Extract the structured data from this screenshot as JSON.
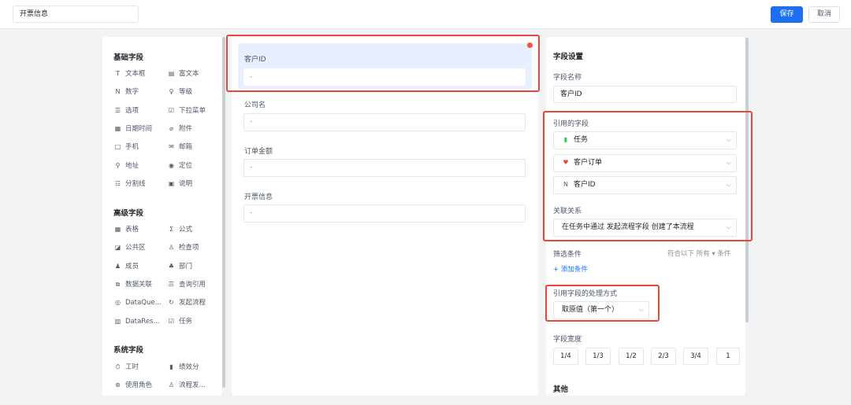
{
  "header": {
    "title_value": "开票信息",
    "save_label": "保存",
    "cancel_label": "取消"
  },
  "left": {
    "groups": [
      {
        "title": "基础字段"
      },
      {
        "title": "高级字段"
      },
      {
        "title": "系统字段"
      }
    ],
    "basic_items": [
      {
        "icon": "text-box-icon",
        "glyph": "T",
        "label": "文本框"
      },
      {
        "icon": "rich-text-icon",
        "glyph": "▤",
        "label": "富文本"
      },
      {
        "icon": "number-icon",
        "glyph": "N",
        "label": "数字"
      },
      {
        "icon": "rating-icon",
        "glyph": "♀",
        "label": "等级"
      },
      {
        "icon": "options-icon",
        "glyph": "☰",
        "label": "选项"
      },
      {
        "icon": "dropdown-icon",
        "glyph": "☑",
        "label": "下拉菜单"
      },
      {
        "icon": "calendar-icon",
        "glyph": "▦",
        "label": "日期时间"
      },
      {
        "icon": "attachment-icon",
        "glyph": "⌀",
        "label": "附件"
      },
      {
        "icon": "phone-icon",
        "glyph": "□",
        "label": "手机"
      },
      {
        "icon": "mail-icon",
        "glyph": "✉",
        "label": "邮箱"
      },
      {
        "icon": "address-icon",
        "glyph": "⚲",
        "label": "地址"
      },
      {
        "icon": "location-icon",
        "glyph": "◉",
        "label": "定位"
      },
      {
        "icon": "divider-icon",
        "glyph": "☷",
        "label": "分割线"
      },
      {
        "icon": "description-icon",
        "glyph": "▣",
        "label": "说明"
      }
    ],
    "advanced_items": [
      {
        "icon": "table-icon",
        "glyph": "▦",
        "label": "表格"
      },
      {
        "icon": "formula-icon",
        "glyph": "Σ",
        "label": "公式"
      },
      {
        "icon": "public-area-icon",
        "glyph": "◪",
        "label": "公共区"
      },
      {
        "icon": "checklist-icon",
        "glyph": "♙",
        "label": "检查项"
      },
      {
        "icon": "member-icon",
        "glyph": "♟",
        "label": "成员"
      },
      {
        "icon": "department-icon",
        "glyph": "♣",
        "label": "部门"
      },
      {
        "icon": "data-link-icon",
        "glyph": "⧉",
        "label": "数据关联"
      },
      {
        "icon": "query-ref-icon",
        "glyph": "☴",
        "label": "查询引用"
      },
      {
        "icon": "dataquery-icon",
        "glyph": "◎",
        "label": "DataQue..."
      },
      {
        "icon": "start-flow-icon",
        "glyph": "↻",
        "label": "发起流程"
      },
      {
        "icon": "dataresult-icon",
        "glyph": "▥",
        "label": "DataRes..."
      },
      {
        "icon": "task-icon",
        "glyph": "☑",
        "label": "任务"
      }
    ],
    "system_items": [
      {
        "icon": "work-hours-icon",
        "glyph": "⏱",
        "label": "工时"
      },
      {
        "icon": "performance-icon",
        "glyph": "▮",
        "label": "绩效分"
      },
      {
        "icon": "role-icon",
        "glyph": "⊛",
        "label": "使用角色"
      },
      {
        "icon": "flow-starter-icon",
        "glyph": "♙",
        "label": "流程发..."
      }
    ]
  },
  "center": {
    "fields": [
      {
        "label": "客户ID",
        "value": "-"
      },
      {
        "label": "公司名",
        "value": "-"
      },
      {
        "label": "订单金额",
        "value": "-"
      },
      {
        "label": "开票信息",
        "value": "-"
      }
    ]
  },
  "right": {
    "title": "字段设置",
    "name_label": "字段名称",
    "name_value": "客户ID",
    "ref_label": "引用的字段",
    "ref_selects": [
      {
        "icon": "task-app-icon",
        "glyph": "▮",
        "color": "#34c759",
        "text": "任务"
      },
      {
        "icon": "heart-icon",
        "glyph": "♥",
        "color": "#e8473b",
        "text": "客户订单"
      },
      {
        "icon": "number-field-icon",
        "glyph": "N",
        "color": "#4e5969",
        "text": "客户ID"
      }
    ],
    "relation_label": "关联关系",
    "relation_value": "在任务中通过 发起流程字段 创建了本流程",
    "filter_label": "筛选条件",
    "filter_right": "符合以下 所有 ▾ 条件",
    "add_condition": "+ 添加条件",
    "handling_label": "引用字段的处理方式",
    "handling_value": "取原值（第一个）",
    "width_label": "字段宽度",
    "widths": [
      "1/4",
      "1/3",
      "1/2",
      "2/3",
      "3/4",
      "1"
    ],
    "other_title": "其他"
  },
  "colors": {
    "accent": "#1d6ff2",
    "highlight": "#e8473b",
    "selected_bg": "#e8efff"
  }
}
